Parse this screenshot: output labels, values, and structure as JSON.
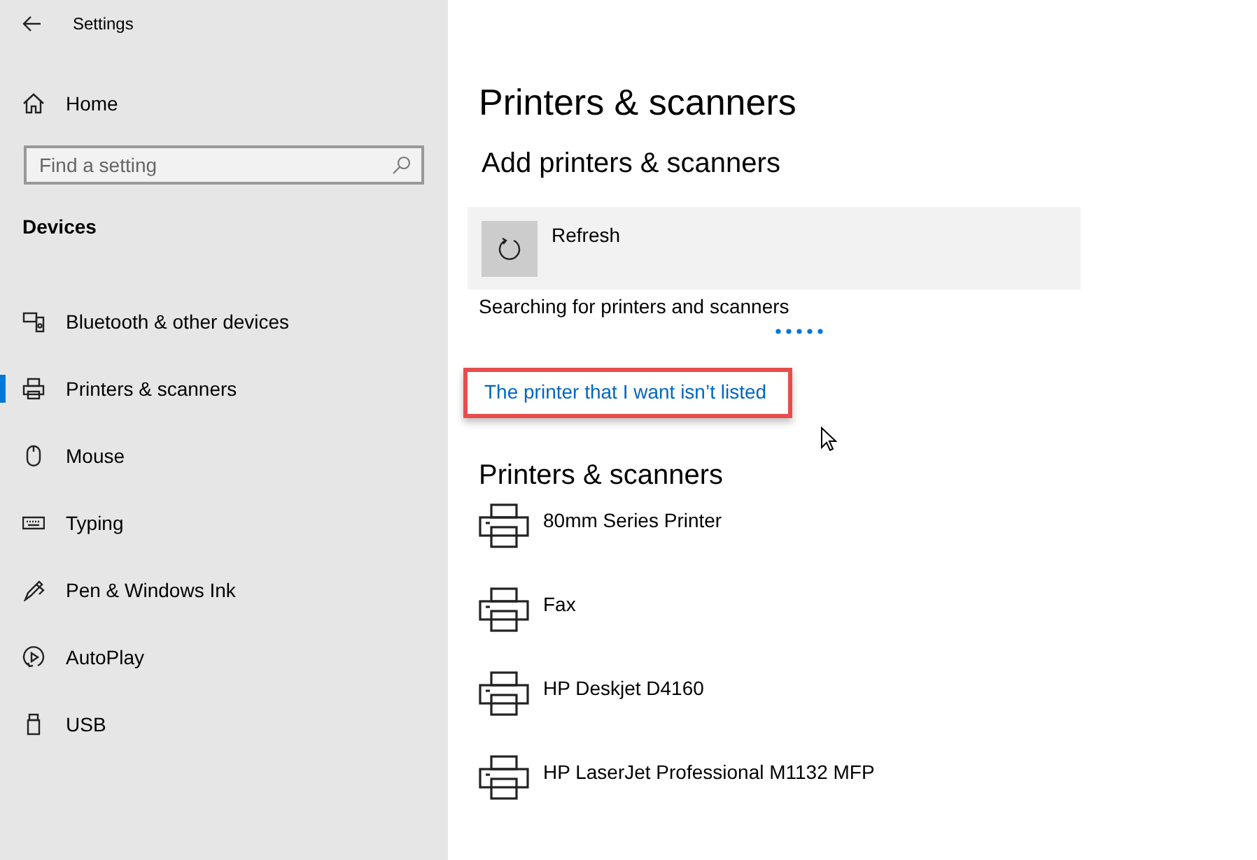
{
  "window": {
    "title": "Settings"
  },
  "sidebar": {
    "home": "Home",
    "search": {
      "placeholder": "Find a setting"
    },
    "section": "Devices",
    "items": [
      {
        "label": "Bluetooth & other devices",
        "selected": false
      },
      {
        "label": "Printers & scanners",
        "selected": true
      },
      {
        "label": "Mouse",
        "selected": false
      },
      {
        "label": "Typing",
        "selected": false
      },
      {
        "label": "Pen & Windows Ink",
        "selected": false
      },
      {
        "label": "AutoPlay",
        "selected": false
      },
      {
        "label": "USB",
        "selected": false
      }
    ]
  },
  "main": {
    "title": "Printers & scanners",
    "add_heading": "Add printers & scanners",
    "refresh": "Refresh",
    "status": "Searching for printers and scanners",
    "searching": true,
    "link": {
      "label": "The printer that I want isn’t listed",
      "highlighted": true
    },
    "list_heading": "Printers & scanners",
    "printers": [
      {
        "name": "80mm Series Printer"
      },
      {
        "name": "Fax"
      },
      {
        "name": "HP Deskjet D4160"
      },
      {
        "name": "HP LaserJet Professional M1132 MFP"
      }
    ]
  }
}
